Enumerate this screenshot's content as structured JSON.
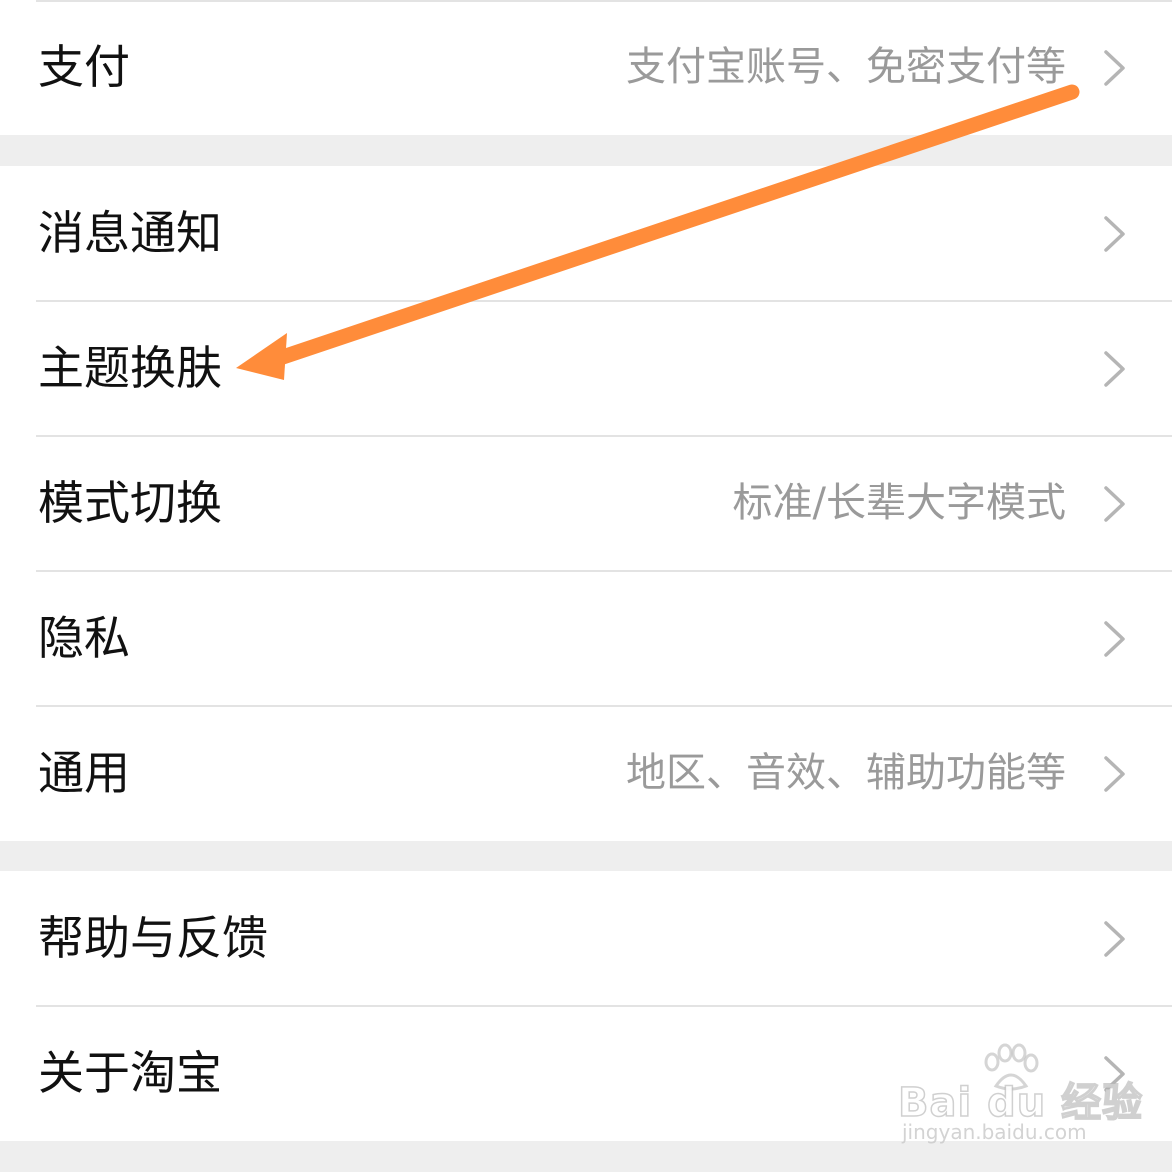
{
  "settings": {
    "group1": {
      "items": [
        {
          "label": "支付",
          "value": "支付宝账号、免密支付等",
          "icon": "chevron-right-icon"
        }
      ]
    },
    "group2": {
      "items": [
        {
          "label": "消息通知",
          "value": "",
          "icon": "chevron-right-icon"
        },
        {
          "label": "主题换肤",
          "value": "",
          "icon": "chevron-right-icon"
        },
        {
          "label": "模式切换",
          "value": "标准/长辈大字模式",
          "icon": "chevron-right-icon"
        },
        {
          "label": "隐私",
          "value": "",
          "icon": "chevron-right-icon"
        },
        {
          "label": "通用",
          "value": "地区、音效、辅助功能等",
          "icon": "chevron-right-icon"
        }
      ]
    },
    "group3": {
      "items": [
        {
          "label": "帮助与反馈",
          "value": "",
          "icon": "chevron-right-icon"
        },
        {
          "label": "关于淘宝",
          "value": "",
          "icon": "chevron-right-icon"
        }
      ]
    }
  },
  "annotation": {
    "type": "arrow",
    "color": "#ff8c3a",
    "target": "主题换肤"
  },
  "watermark": {
    "brand": "Bai du 经验",
    "site": "jingyan.baidu.com"
  },
  "colors": {
    "background": "#eeeeee",
    "row_background": "#ffffff",
    "label_text": "#111111",
    "value_text": "#9a9a9a",
    "chevron": "#b5b5b5",
    "divider": "#e3e3e3"
  }
}
